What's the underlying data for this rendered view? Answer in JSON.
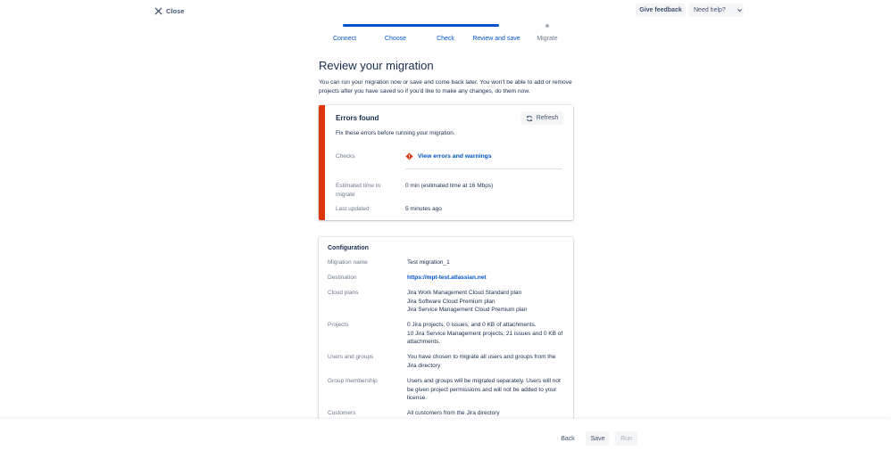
{
  "header": {
    "close_label": "Close",
    "feedback_label": "Give feedback",
    "help_label": "Need help?"
  },
  "stepper": {
    "steps": [
      {
        "label": "Connect",
        "state": "done"
      },
      {
        "label": "Choose",
        "state": "done"
      },
      {
        "label": "Check",
        "state": "done"
      },
      {
        "label": "Review and save",
        "state": "current"
      },
      {
        "label": "Migrate",
        "state": "future"
      }
    ]
  },
  "page": {
    "title": "Review your migration",
    "intro": "You can run your migration now or save and come back later. You won't be able to add or remove projects after you have saved so if you'd like to make any changes, do them now."
  },
  "errors": {
    "title": "Errors found",
    "refresh_label": "Refresh",
    "subtitle": "Fix these errors before running your migration.",
    "checks_label": "Checks",
    "checks_link": "View errors and warnings",
    "estimated_label": "Estimated time to migrate",
    "estimated_value": "0 min (estimated time at 16 Mbps)",
    "updated_label": "Last updated",
    "updated_value": "5 minutes ago",
    "accent_color": "#de350b"
  },
  "configuration": {
    "title": "Configuration",
    "rows": [
      {
        "label": "Migration name",
        "value": "Test migration_1"
      },
      {
        "label": "Destination",
        "value": "https://mpt-test.atlassian.net"
      },
      {
        "label": "Cloud plans",
        "value_lines": [
          "Jira Work Management Cloud Standard plan",
          "Jira Software Cloud Premium plan",
          "Jira Service Management Cloud Premium plan"
        ]
      },
      {
        "label": "Projects",
        "value_lines": [
          "0 Jira projects, 0 issues, and 0 KB of attachments.",
          "10 Jira Service Management projects, 21 issues and 0 KB of attachments."
        ]
      },
      {
        "label": "Users and groups",
        "value": "You have chosen to migrate all users and groups from the Jira directory"
      },
      {
        "label": "Group membership",
        "value": "Users and groups will be migrated separately. Users will not be given project permissions and will not be added to your license."
      },
      {
        "label": "Customers",
        "value": "All customers from the Jira directory"
      }
    ]
  },
  "footer": {
    "back_label": "Back",
    "save_label": "Save",
    "run_label": "Run"
  },
  "colors": {
    "brand_blue": "#0052cc",
    "text": "#172b4d",
    "subtle": "#6b778c"
  }
}
